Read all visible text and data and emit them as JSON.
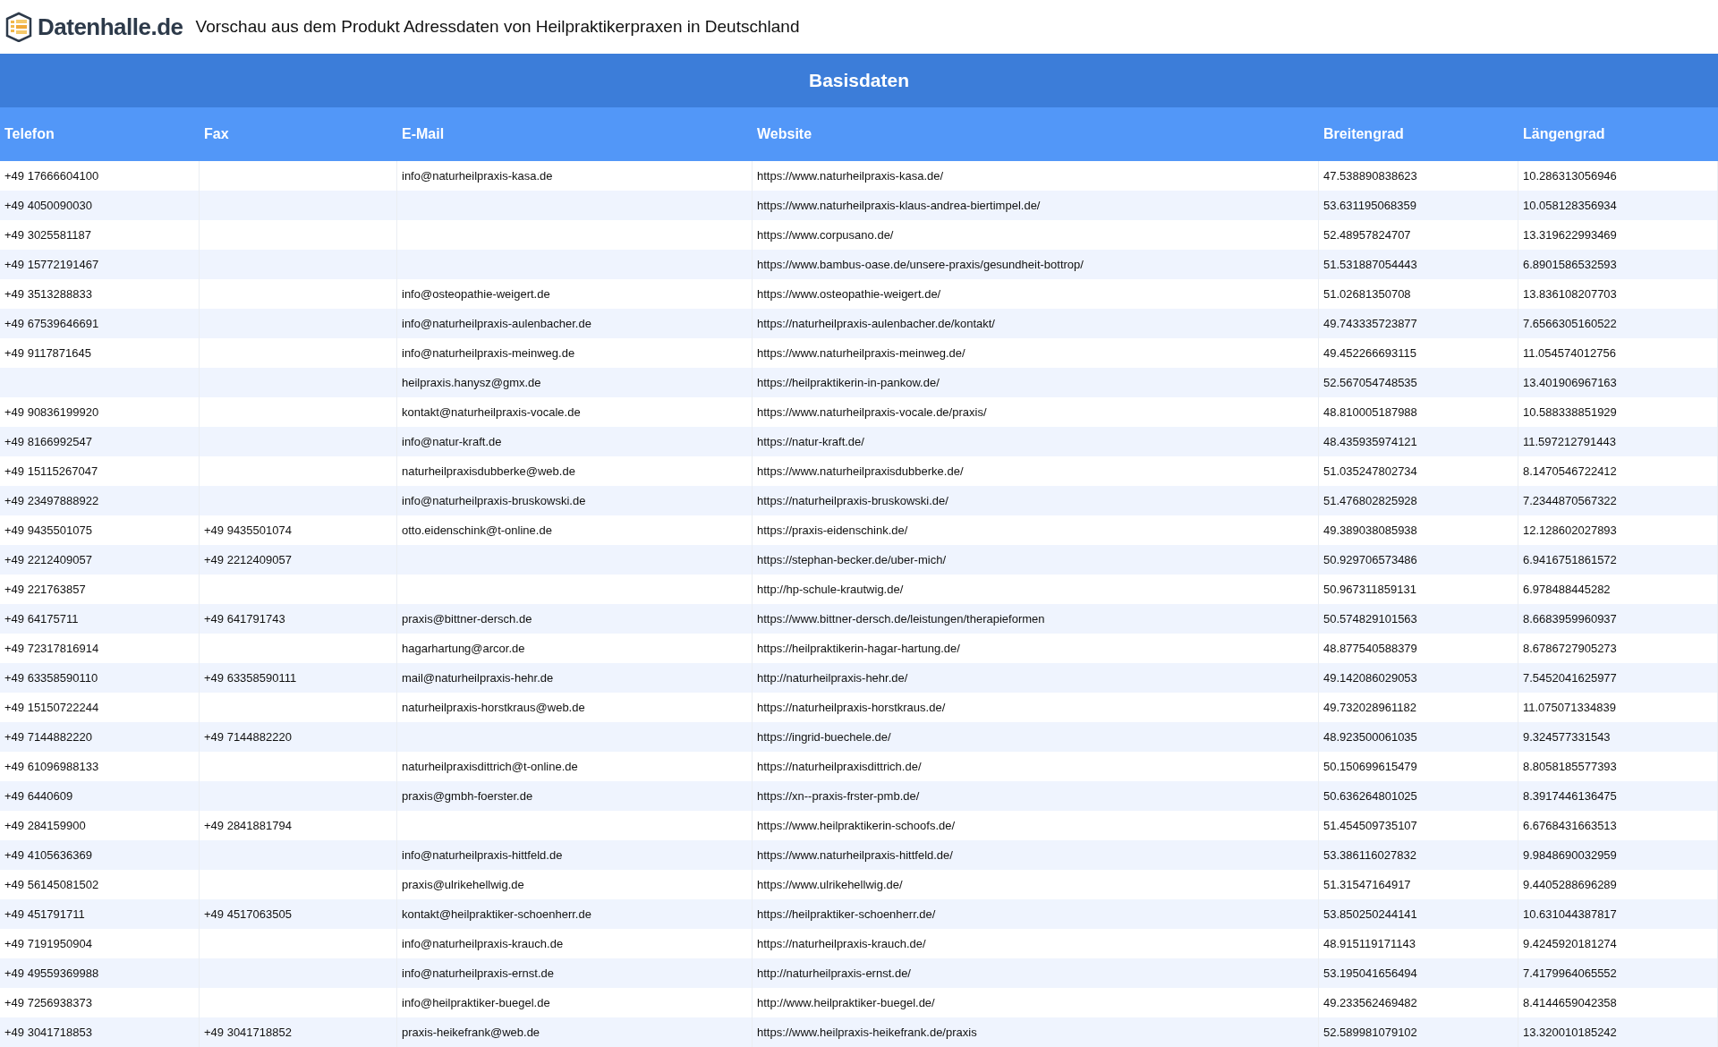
{
  "header": {
    "logo_text": "Datenhalle.de",
    "title": "Vorschau aus dem Produkt Adressdaten von Heilpraktikerpraxen in Deutschland"
  },
  "table": {
    "group_title": "Basisdaten",
    "columns": [
      "Telefon",
      "Fax",
      "E-Mail",
      "Website",
      "Breitengrad",
      "Längengrad"
    ],
    "rows": [
      [
        "+49 17666604100",
        null,
        "info@naturheilpraxis-kasa.de",
        "https://www.naturheilpraxis-kasa.de/",
        "47.538890838623",
        "10.286313056946"
      ],
      [
        "+49 4050090030",
        null,
        null,
        "https://www.naturheilpraxis-klaus-andrea-biertimpel.de/",
        "53.631195068359",
        "10.058128356934"
      ],
      [
        "+49 3025581187",
        null,
        null,
        "https://www.corpusano.de/",
        "52.48957824707",
        "13.319622993469"
      ],
      [
        "+49 15772191467",
        null,
        null,
        "https://www.bambus-oase.de/unsere-praxis/gesundheit-bottrop/",
        "51.531887054443",
        "6.8901586532593"
      ],
      [
        "+49 3513288833",
        null,
        "info@osteopathie-weigert.de",
        "https://www.osteopathie-weigert.de/",
        "51.02681350708",
        "13.836108207703"
      ],
      [
        "+49 67539646691",
        null,
        "info@naturheilpraxis-aulenbacher.de",
        "https://naturheilpraxis-aulenbacher.de/kontakt/",
        "49.743335723877",
        "7.6566305160522"
      ],
      [
        "+49 9117871645",
        null,
        "info@naturheilpraxis-meinweg.de",
        "https://www.naturheilpraxis-meinweg.de/",
        "49.452266693115",
        "11.054574012756"
      ],
      [
        null,
        null,
        "heilpraxis.hanysz@gmx.de",
        "https://heilpraktikerin-in-pankow.de/",
        "52.567054748535",
        "13.401906967163"
      ],
      [
        "+49 90836199920",
        null,
        "kontakt@naturheilpraxis-vocale.de",
        "https://www.naturheilpraxis-vocale.de/praxis/",
        "48.810005187988",
        "10.588338851929"
      ],
      [
        "+49 8166992547",
        null,
        "info@natur-kraft.de",
        "https://natur-kraft.de/",
        "48.435935974121",
        "11.597212791443"
      ],
      [
        "+49 15115267047",
        null,
        "naturheilpraxisdubberke@web.de",
        "https://www.naturheilpraxisdubberke.de/",
        "51.035247802734",
        "8.1470546722412"
      ],
      [
        "+49 23497888922",
        null,
        "info@naturheilpraxis-bruskowski.de",
        "https://naturheilpraxis-bruskowski.de/",
        "51.476802825928",
        "7.2344870567322"
      ],
      [
        "+49 9435501075",
        "+49 9435501074",
        "otto.eidenschink@t-online.de",
        "https://praxis-eidenschink.de/",
        "49.389038085938",
        "12.128602027893"
      ],
      [
        "+49 2212409057",
        "+49 2212409057",
        null,
        "https://stephan-becker.de/uber-mich/",
        "50.929706573486",
        "6.9416751861572"
      ],
      [
        "+49 221763857",
        null,
        null,
        "http://hp-schule-krautwig.de/",
        "50.967311859131",
        "6.978488445282"
      ],
      [
        "+49 64175711",
        "+49 641791743",
        "praxis@bittner-dersch.de",
        "https://www.bittner-dersch.de/leistungen/therapieformen",
        "50.574829101563",
        "8.6683959960937"
      ],
      [
        "+49 72317816914",
        null,
        "hagarhartung@arcor.de",
        "https://heilpraktikerin-hagar-hartung.de/",
        "48.877540588379",
        "8.6786727905273"
      ],
      [
        "+49 63358590110",
        "+49 63358590111",
        "mail@naturheilpraxis-hehr.de",
        "http://naturheilpraxis-hehr.de/",
        "49.142086029053",
        "7.5452041625977"
      ],
      [
        "+49 15150722244",
        null,
        "naturheilpraxis-horstkraus@web.de",
        "https://naturheilpraxis-horstkraus.de/",
        "49.732028961182",
        "11.075071334839"
      ],
      [
        "+49 7144882220",
        "+49 7144882220",
        null,
        "https://ingrid-buechele.de/",
        "48.923500061035",
        "9.324577331543"
      ],
      [
        "+49 61096988133",
        null,
        "naturheilpraxisdittrich@t-online.de",
        "https://naturheilpraxisdittrich.de/",
        "50.150699615479",
        "8.8058185577393"
      ],
      [
        "+49 6440609",
        null,
        "praxis@gmbh-foerster.de",
        "https://xn--praxis-frster-pmb.de/",
        "50.636264801025",
        "8.3917446136475"
      ],
      [
        "+49 284159900",
        "+49 2841881794",
        null,
        "https://www.heilpraktikerin-schoofs.de/",
        "51.454509735107",
        "6.6768431663513"
      ],
      [
        "+49 4105636369",
        null,
        "info@naturheilpraxis-hittfeld.de",
        "https://www.naturheilpraxis-hittfeld.de/",
        "53.386116027832",
        "9.9848690032959"
      ],
      [
        "+49 56145081502",
        null,
        "praxis@ulrikehellwig.de",
        "https://www.ulrikehellwig.de/",
        "51.31547164917",
        "9.4405288696289"
      ],
      [
        "+49 451791711",
        "+49 4517063505",
        "kontakt@heilpraktiker-schoenherr.de",
        "https://heilpraktiker-schoenherr.de/",
        "53.850250244141",
        "10.631044387817"
      ],
      [
        "+49 7191950904",
        null,
        "info@naturheilpraxis-krauch.de",
        "https://naturheilpraxis-krauch.de/",
        "48.915119171143",
        "9.4245920181274"
      ],
      [
        "+49 49559369988",
        null,
        "info@naturheilpraxis-ernst.de",
        "http://naturheilpraxis-ernst.de/",
        "53.195041656494",
        "7.4179964065552"
      ],
      [
        "+49 7256938373",
        null,
        "info@heilpraktiker-buegel.de",
        "http://www.heilpraktiker-buegel.de/",
        "49.233562469482",
        "8.4144659042358"
      ],
      [
        "+49 3041718853",
        "+49 3041718852",
        "praxis-heikefrank@web.de",
        "https://www.heilpraxis-heikefrank.de/praxis",
        "52.589981079102",
        "13.320010185242"
      ]
    ]
  }
}
